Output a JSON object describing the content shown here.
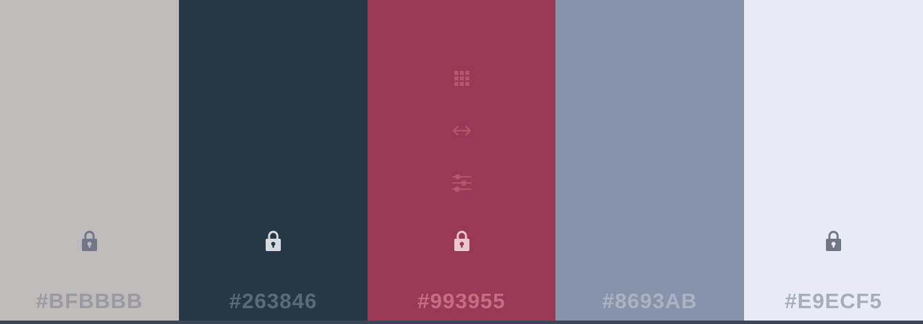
{
  "palette": {
    "swatches": [
      {
        "hex_label": "#BFBBBB",
        "color": "#BFBBBB",
        "label_color": "#9a9aa3",
        "lock_color": "#6f7789",
        "lock_keyhole": "#BFBBBB",
        "tools_visible": false
      },
      {
        "hex_label": "#263846",
        "color": "#263846",
        "label_color": "#5a6a77",
        "lock_color": "#d7dbe0",
        "lock_keyhole": "#263846",
        "tools_visible": false
      },
      {
        "hex_label": "#993955",
        "color": "#993955",
        "label_color": "#c76c86",
        "lock_color": "#e9c6d0",
        "lock_keyhole": "#993955",
        "tools_visible": true,
        "tool_color": "#b5566f"
      },
      {
        "hex_label": "#8693AB",
        "color": "#8693AB",
        "label_color": "#a9b3c5",
        "lock_color": null,
        "tools_visible": false
      },
      {
        "hex_label": "#E9ECF5",
        "color": "#E9ECF5",
        "label_color": "#a9adb8",
        "lock_color": "#6f7789",
        "lock_keyhole": "#E9ECF5",
        "tools_visible": false
      }
    ],
    "tools": [
      "grid-icon",
      "drag-arrows-icon",
      "adjust-sliders-icon"
    ],
    "lock_icon": "lock-icon"
  }
}
